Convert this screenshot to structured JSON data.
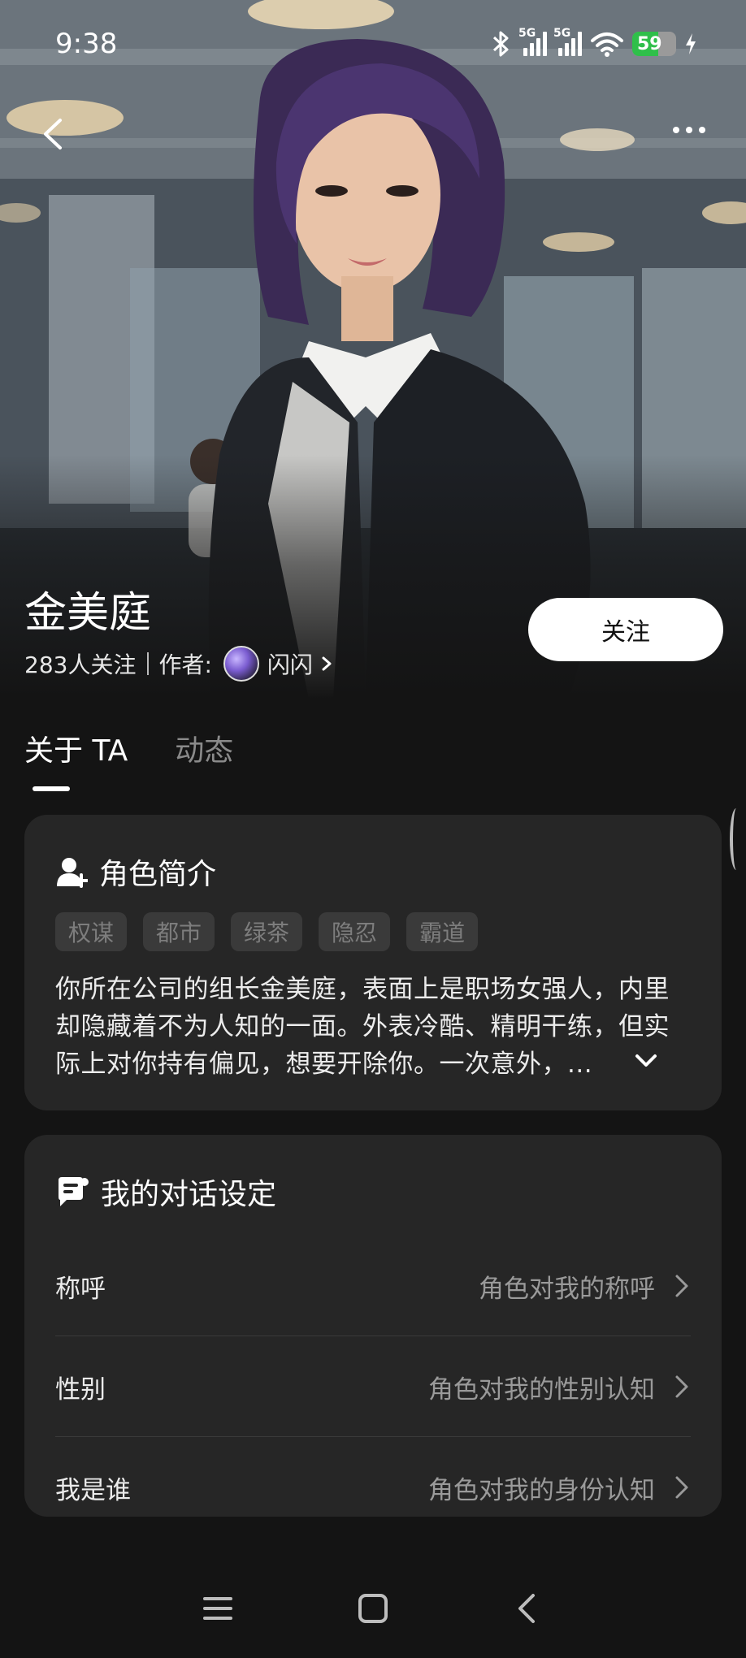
{
  "status_bar": {
    "time": "9:38",
    "network_1": "5G",
    "network_2": "5G",
    "battery_level": "59",
    "battery_fraction": 0.59
  },
  "profile": {
    "name": "金美庭",
    "followers": "283人关注",
    "author_prefix": "作者:",
    "author_name": "闪闪",
    "follow_label": "关注"
  },
  "tabs": [
    {
      "label": "关于 TA",
      "active": true
    },
    {
      "label": "动态",
      "active": false
    }
  ],
  "intro": {
    "title": "角色简介",
    "tags": [
      "权谋",
      "都市",
      "绿茶",
      "隐忍",
      "霸道"
    ],
    "description_lines": [
      "你所在公司的组长金美庭，表面上是职场女强人，内里",
      "却隐藏着不为人知的一面。外表冷酷、精明干练，但实",
      "际上对你持有偏见，想要开除你。一次意外，..."
    ]
  },
  "settings": {
    "title": "我的对话设定",
    "rows": [
      {
        "label": "称呼",
        "value": "角色对我的称呼"
      },
      {
        "label": "性别",
        "value": "角色对我的性别认知"
      },
      {
        "label": "我是谁",
        "value": "角色对我的身份认知"
      }
    ]
  },
  "colors": {
    "background": "#141414",
    "card": "#262626",
    "tag_bg": "#3a3a3a",
    "battery_green": "#2fbf4a"
  },
  "icons": [
    "back-icon",
    "more-icon",
    "person-add-icon",
    "chat-settings-icon",
    "chevron-right-icon",
    "chevron-down-icon",
    "menu-icon",
    "home-icon",
    "nav-back-icon"
  ]
}
